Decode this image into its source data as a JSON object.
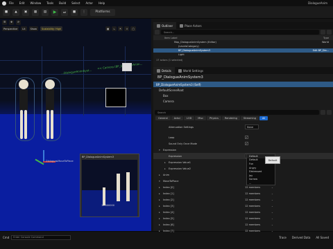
{
  "menubar": {
    "items": [
      "File",
      "Edit",
      "Window",
      "Tools",
      "Build",
      "Select",
      "Actor",
      "Help"
    ],
    "window_title": "DialogueAnim"
  },
  "toolbar": {
    "platforms_label": "Platforms"
  },
  "viewport": {
    "chips": [
      "Perspective",
      "Lit",
      "Show"
    ],
    "scalability": "Scalability: High",
    "camera_label": "<< Camera (BP_DialogueAnim...",
    "secondary_label": "...DialogueAnimSyst...",
    "actor_label": "Dialogue▸MoveToPlace",
    "preview_title": "BP_DialogueAnimSystem3",
    "preview_time": "10.000000"
  },
  "bottombar": {
    "console_label": "Cmd",
    "console_placeholder": "Enter Console Command",
    "trace_label": "Trace",
    "derived_label": "Derived Data",
    "all_saved_label": "All Saved"
  },
  "outliner": {
    "tabs": [
      "Outliner",
      "Place Actors"
    ],
    "search_placeholder": "Search...",
    "col_label": "Item Label",
    "col_type": "Type",
    "rows": [
      {
        "label": "Map_DialogueAnimSystem (Editor)",
        "type": "World",
        "sel": false,
        "indent": 30
      },
      {
        "label": "(LevelsCategory)",
        "type": "",
        "sel": false,
        "indent": 36
      },
      {
        "label": "BP_DialogueAnimSystem3",
        "type": "Edit BP_Dia...",
        "sel": true,
        "indent": 36
      },
      {
        "label": "Light",
        "type": "",
        "sel": false,
        "indent": 36
      }
    ],
    "status": "17 actors (1 selected)"
  },
  "details": {
    "tabs": [
      "Details",
      "World Settings"
    ],
    "title": "BP_DialogueAnimSystem3",
    "components": [
      {
        "label": "BP_DialogueAnimSystem3 (Self)",
        "sel": true,
        "indent": 4
      },
      {
        "label": "DefaultSceneRoot",
        "sel": false,
        "indent": 8
      },
      {
        "label": "Box",
        "sel": false,
        "indent": 14
      },
      {
        "label": "Camera",
        "sel": false,
        "indent": 14
      }
    ],
    "search_placeholder": "Search",
    "categories": [
      "General",
      "Actor",
      "LOD",
      "Misc",
      "Physics",
      "Rendering",
      "Streaming",
      "All"
    ],
    "active_category": "All",
    "properties": [
      {
        "name": "Attenuation Settings",
        "indent": 22,
        "value": "None",
        "kind": "combo"
      },
      {
        "name": "Loop",
        "indent": 22,
        "value": "",
        "kind": "check"
      },
      {
        "name": "Sound Only Once Mode",
        "indent": 22,
        "value": "",
        "kind": "check"
      },
      {
        "name": "Expression",
        "indent": 14,
        "value": "",
        "kind": "group"
      },
      {
        "name": "Expression",
        "indent": 22,
        "value": "Default",
        "kind": "combo-sel"
      },
      {
        "name": "Expression Value1",
        "indent": 22,
        "value": "",
        "kind": "none"
      },
      {
        "name": "Expression Value2",
        "indent": 22,
        "value": "",
        "kind": "none"
      },
      {
        "name": "Anim",
        "indent": 14,
        "value": "",
        "kind": "group"
      },
      {
        "name": "MoveToPlace",
        "indent": 14,
        "value": "",
        "kind": "group"
      },
      {
        "name": "Index [0]",
        "indent": 14,
        "value": "12 members",
        "kind": "array"
      },
      {
        "name": "Index [1]",
        "indent": 14,
        "value": "12 members",
        "kind": "array"
      },
      {
        "name": "Index [2]",
        "indent": 14,
        "value": "12 members",
        "kind": "array"
      },
      {
        "name": "Index [3]",
        "indent": 14,
        "value": "12 members",
        "kind": "array"
      },
      {
        "name": "Index [4]",
        "indent": 14,
        "value": "12 members",
        "kind": "array"
      },
      {
        "name": "Index [5]",
        "indent": 14,
        "value": "12 members",
        "kind": "array"
      },
      {
        "name": "Index [6]",
        "indent": 14,
        "value": "12 members",
        "kind": "array"
      },
      {
        "name": "Index [7]",
        "indent": 14,
        "value": "12 members",
        "kind": "array"
      }
    ],
    "dropdown_items": [
      "Default",
      "Default",
      "Fun",
      "Angry",
      "Distressed",
      "Joy",
      "Sorrow",
      "..."
    ],
    "tooltip": "Default"
  }
}
